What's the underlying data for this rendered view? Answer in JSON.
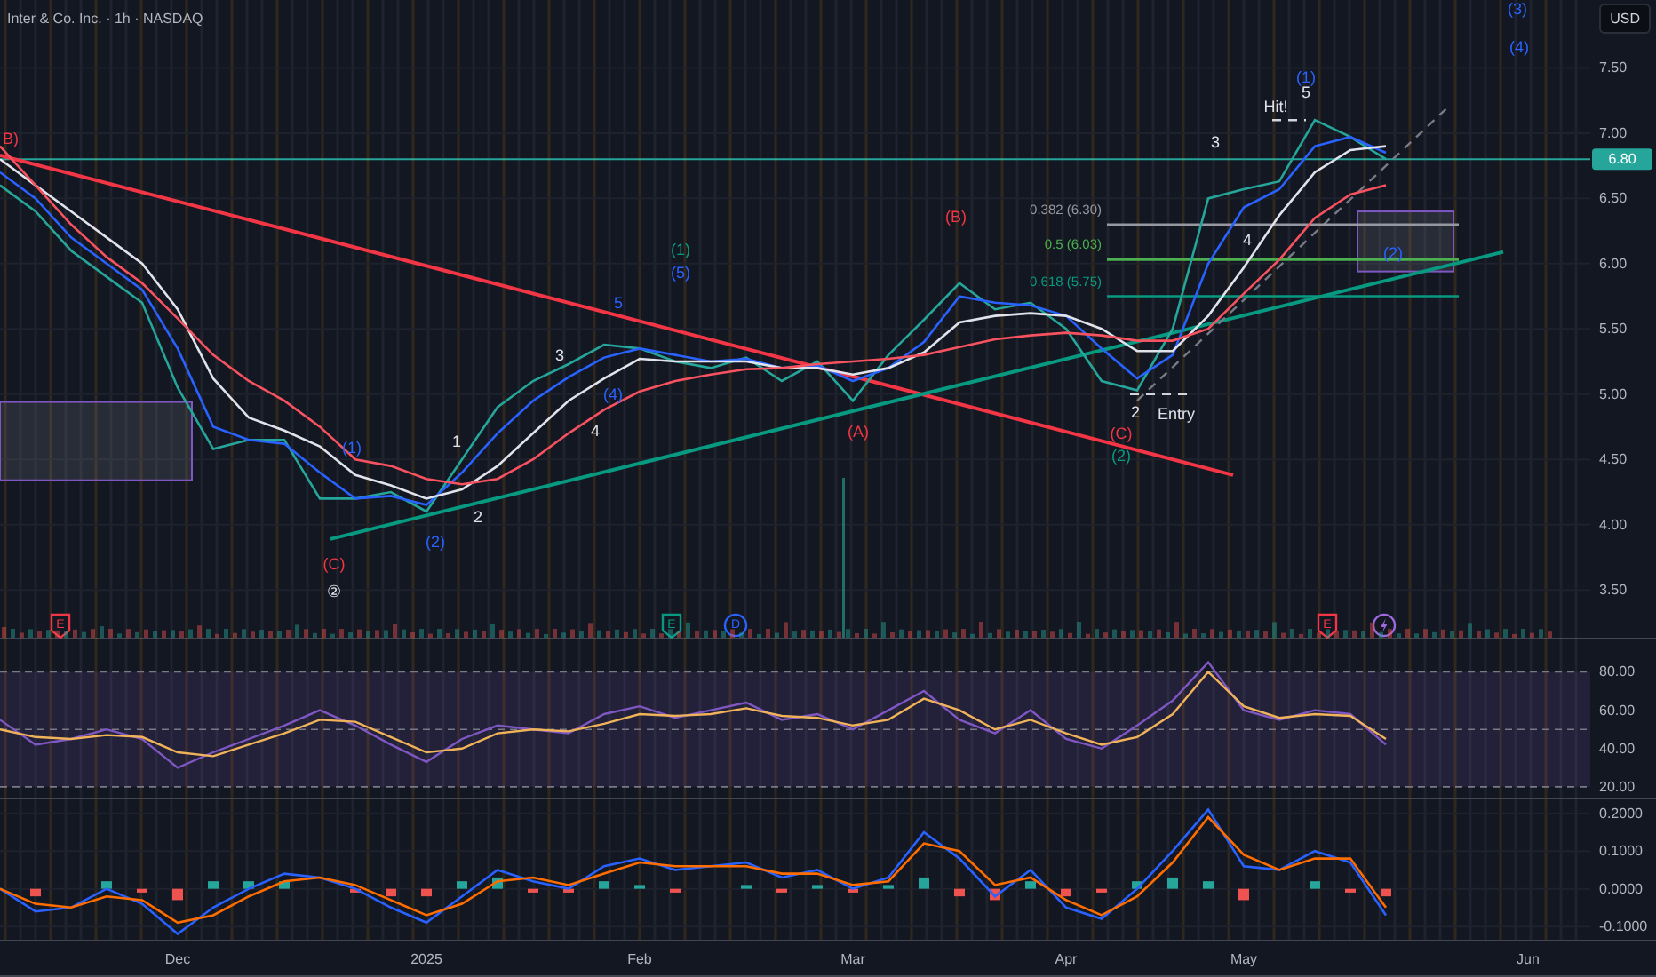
{
  "header": {
    "title": "Inter & Co. Inc. · 1h · NASDAQ",
    "currency": "USD"
  },
  "price_chart": {
    "chart_data": {
      "type": "line",
      "grid": true,
      "categories": [
        null,
        null,
        null,
        null,
        null,
        null,
        null,
        null,
        null,
        null,
        null,
        null,
        null,
        null,
        null,
        null,
        null,
        null,
        null,
        null,
        null,
        null,
        null,
        null,
        null,
        null,
        null,
        null,
        null,
        null,
        null,
        null,
        null,
        null,
        null,
        null,
        null,
        null,
        null,
        null,
        null,
        null,
        null,
        null,
        null
      ],
      "series": [
        {
          "color": "#26a69a",
          "values": [
            6.6,
            6.4,
            6.1,
            5.9,
            5.7,
            5.05,
            4.58,
            4.65,
            4.65,
            4.2,
            4.2,
            4.25,
            4.1,
            4.5,
            4.9,
            5.1,
            5.23,
            5.38,
            5.35,
            5.25,
            5.2,
            5.28,
            5.1,
            5.25,
            4.95,
            5.3,
            5.57,
            5.85,
            5.65,
            5.7,
            5.5,
            5.1,
            5.03,
            5.5,
            6.5,
            6.57,
            6.63,
            7.1,
            6.97,
            6.8,
            null,
            null,
            null,
            null,
            null
          ]
        },
        {
          "color": "#2962ff",
          "values": [
            6.7,
            6.5,
            6.2,
            6.0,
            5.8,
            5.35,
            4.75,
            4.65,
            4.62,
            4.4,
            4.2,
            4.22,
            4.15,
            4.4,
            4.7,
            4.95,
            5.13,
            5.28,
            5.35,
            5.3,
            5.25,
            5.27,
            5.2,
            5.22,
            5.1,
            5.2,
            5.4,
            5.75,
            5.7,
            5.68,
            5.6,
            5.35,
            5.12,
            5.3,
            6.0,
            6.43,
            6.57,
            6.9,
            6.97,
            6.85,
            null,
            null,
            null,
            null,
            null
          ]
        },
        {
          "color": "#e0e3eb",
          "values": [
            6.8,
            6.6,
            6.4,
            6.2,
            6.0,
            5.65,
            5.12,
            4.82,
            4.72,
            4.6,
            4.38,
            4.3,
            4.2,
            4.27,
            4.45,
            4.7,
            4.95,
            5.12,
            5.27,
            5.25,
            5.25,
            5.25,
            5.2,
            5.2,
            5.15,
            5.2,
            5.32,
            5.55,
            5.6,
            5.62,
            5.6,
            5.5,
            5.33,
            5.33,
            5.6,
            5.97,
            6.37,
            6.7,
            6.87,
            6.9,
            null,
            null,
            null,
            null,
            null
          ]
        },
        {
          "color": "#f7525f",
          "values": [
            6.9,
            6.6,
            6.3,
            6.05,
            5.85,
            5.58,
            5.3,
            5.1,
            4.95,
            4.75,
            4.5,
            4.45,
            4.35,
            4.31,
            4.35,
            4.5,
            4.7,
            4.88,
            5.02,
            5.1,
            5.15,
            5.19,
            5.2,
            5.23,
            5.25,
            5.27,
            5.3,
            5.36,
            5.42,
            5.45,
            5.47,
            5.45,
            5.41,
            5.41,
            5.5,
            5.77,
            6.03,
            6.35,
            6.53,
            6.6,
            null,
            null,
            null,
            null,
            null
          ]
        }
      ],
      "ylim": [
        3.12,
        8.02
      ],
      "yticks": [
        {
          "value": 3.5,
          "label": "3.50"
        },
        {
          "value": 4,
          "label": "4.00"
        },
        {
          "value": 4.5,
          "label": "4.50"
        },
        {
          "value": 5,
          "label": "5.00"
        },
        {
          "value": 5.5,
          "label": "5.50"
        },
        {
          "value": 6,
          "label": "6.00"
        },
        {
          "value": 6.5,
          "label": "6.50"
        },
        {
          "value": 7,
          "label": "7.00"
        },
        {
          "value": 7.5,
          "label": "7.50"
        }
      ]
    },
    "fib_levels": [
      {
        "label": "0.382 (6.30)",
        "color": "#9598a1"
      },
      {
        "label": "0.5 (6.03)",
        "color": "#4caf50"
      },
      {
        "label": "0.618 (5.75)",
        "color": "#089981"
      }
    ],
    "wave_labels": [
      {
        "text": "B)",
        "color": "#f23645"
      },
      {
        "text": "(1)",
        "color": "#089981"
      },
      {
        "text": "(5)",
        "color": "#2962ff"
      },
      {
        "text": "3",
        "color": "#e0e3eb"
      },
      {
        "text": "5",
        "color": "#2962ff"
      },
      {
        "text": "1",
        "color": "#e0e3eb"
      },
      {
        "text": "2",
        "color": "#e0e3eb"
      },
      {
        "text": "(1)",
        "color": "#2962ff"
      },
      {
        "text": "(2)",
        "color": "#2962ff"
      },
      {
        "text": "(C)",
        "color": "#f23645"
      },
      {
        "text": "②",
        "color": "#e0e3eb"
      },
      {
        "text": "(4)",
        "color": "#2962ff"
      },
      {
        "text": "4",
        "color": "#e0e3eb"
      },
      {
        "text": "(A)",
        "color": "#f23645"
      },
      {
        "text": "(B)",
        "color": "#f23645"
      },
      {
        "text": "(C)",
        "color": "#f23645"
      },
      {
        "text": "(2)",
        "color": "#089981"
      },
      {
        "text": "2",
        "color": "#e0e3eb"
      },
      {
        "text": "Entry",
        "color": "#e0e3eb"
      },
      {
        "text": "3",
        "color": "#e0e3eb"
      },
      {
        "text": "4",
        "color": "#e0e3eb"
      },
      {
        "text": "Hit!",
        "color": "#e0e3eb"
      },
      {
        "text": "(1)",
        "color": "#2962ff"
      },
      {
        "text": "5",
        "color": "#e0e3eb"
      },
      {
        "text": "(2)",
        "color": "#2962ff"
      },
      {
        "text": "(3)",
        "color": "#2962ff"
      },
      {
        "text": "(4)",
        "color": "#2962ff"
      }
    ],
    "last_price": {
      "text": "6.80",
      "color": "#26a69a"
    },
    "events": [
      {
        "kind": "badge",
        "text": "E",
        "color": "#f23645"
      },
      {
        "kind": "badge",
        "text": "E",
        "color": "#089981"
      },
      {
        "kind": "circle",
        "text": "D",
        "color": "#2962ff"
      },
      {
        "kind": "badge",
        "text": "E",
        "color": "#f23645"
      },
      {
        "kind": "bolt",
        "color": "#9c6ade"
      }
    ]
  },
  "rsi_chart": {
    "chart_data": {
      "type": "line",
      "grid": true,
      "categories": [
        null,
        null,
        null,
        null,
        null,
        null,
        null,
        null,
        null,
        null,
        null,
        null,
        null,
        null,
        null,
        null,
        null,
        null,
        null,
        null,
        null,
        null,
        null,
        null,
        null,
        null,
        null,
        null,
        null,
        null,
        null,
        null,
        null,
        null,
        null,
        null,
        null,
        null,
        null,
        null,
        null,
        null,
        null,
        null,
        null
      ],
      "series": [
        {
          "color": "#7e57c2",
          "values": [
            55,
            42,
            45,
            50,
            45,
            30,
            38,
            45,
            52,
            60,
            52,
            42,
            33,
            45,
            52,
            50,
            48,
            58,
            62,
            56,
            60,
            64,
            55,
            58,
            50,
            60,
            70,
            55,
            48,
            60,
            45,
            40,
            52,
            65,
            85,
            60,
            55,
            60,
            58,
            42,
            null,
            null,
            null,
            null,
            null
          ]
        },
        {
          "color": "#f0b35a",
          "values": [
            50,
            46,
            45,
            47,
            46,
            38,
            36,
            42,
            48,
            55,
            54,
            46,
            38,
            40,
            48,
            50,
            49,
            53,
            58,
            57,
            58,
            61,
            57,
            56,
            52,
            55,
            66,
            60,
            50,
            55,
            48,
            42,
            46,
            58,
            80,
            62,
            56,
            58,
            57,
            45,
            null,
            null,
            null,
            null,
            null
          ]
        }
      ],
      "ylim": [
        14.4,
        96.9
      ],
      "yticks": [
        {
          "value": 20,
          "label": "20.00"
        },
        {
          "value": 40,
          "label": "40.00"
        },
        {
          "value": 60,
          "label": "60.00"
        },
        {
          "value": 80,
          "label": "80.00"
        }
      ]
    }
  },
  "macd_chart": {
    "chart_data": {
      "type": "line",
      "grid": true,
      "categories": [
        null,
        null,
        null,
        null,
        null,
        "Dec",
        null,
        null,
        null,
        null,
        null,
        null,
        "2025",
        null,
        null,
        null,
        null,
        null,
        "Feb",
        null,
        null,
        null,
        null,
        null,
        "Mar",
        null,
        null,
        null,
        null,
        null,
        "Apr",
        null,
        null,
        null,
        null,
        "May",
        null,
        null,
        null,
        null,
        null,
        null,
        null,
        "Jun",
        null
      ],
      "series": [
        {
          "type": "bar",
          "color": "#26a69a",
          "values": [
            null,
            null,
            null,
            0.02,
            null,
            null,
            0.02,
            0.02,
            0.02,
            null,
            null,
            null,
            null,
            0.02,
            0.03,
            null,
            null,
            0.02,
            0.01,
            null,
            null,
            0.01,
            null,
            0.01,
            null,
            0.01,
            0.03,
            null,
            null,
            0.02,
            null,
            null,
            0.02,
            0.03,
            0.02,
            null,
            null,
            0.02,
            null,
            null,
            null,
            null,
            null,
            null,
            null
          ]
        },
        {
          "type": "bar",
          "color": "#ef5350",
          "values": [
            null,
            -0.02,
            null,
            null,
            -0.01,
            -0.03,
            null,
            null,
            null,
            null,
            -0.01,
            -0.02,
            -0.02,
            null,
            null,
            -0.01,
            -0.01,
            null,
            null,
            -0.01,
            null,
            null,
            -0.01,
            null,
            -0.01,
            null,
            null,
            -0.02,
            -0.03,
            null,
            -0.02,
            -0.01,
            null,
            null,
            null,
            -0.03,
            null,
            null,
            -0.01,
            -0.02,
            null,
            null,
            null,
            null,
            null
          ]
        },
        {
          "color": "#2962ff",
          "values": [
            0.0,
            -0.06,
            -0.05,
            0.0,
            -0.04,
            -0.12,
            -0.05,
            0.0,
            0.04,
            0.03,
            0.0,
            -0.05,
            -0.09,
            -0.02,
            0.05,
            0.02,
            0.0,
            0.06,
            0.08,
            0.05,
            0.06,
            0.07,
            0.03,
            0.05,
            0.0,
            0.03,
            0.15,
            0.08,
            -0.02,
            0.05,
            -0.05,
            -0.08,
            0.0,
            0.1,
            0.21,
            0.06,
            0.05,
            0.1,
            0.07,
            -0.07,
            null,
            null,
            null,
            null,
            null
          ]
        },
        {
          "color": "#ff6d00",
          "values": [
            0.0,
            -0.04,
            -0.05,
            -0.02,
            -0.03,
            -0.09,
            -0.07,
            -0.02,
            0.02,
            0.03,
            0.01,
            -0.03,
            -0.07,
            -0.04,
            0.02,
            0.03,
            0.01,
            0.04,
            0.07,
            0.06,
            0.06,
            0.06,
            0.04,
            0.04,
            0.01,
            0.02,
            0.12,
            0.1,
            0.01,
            0.03,
            -0.03,
            -0.07,
            -0.02,
            0.07,
            0.19,
            0.09,
            0.05,
            0.08,
            0.08,
            -0.05,
            null,
            null,
            null,
            null,
            null
          ]
        }
      ],
      "ylim": [
        -0.135,
        0.237
      ],
      "yticks": [
        {
          "value": -0.1,
          "label": "-0.1000"
        },
        {
          "value": 0,
          "label": "0.0000"
        },
        {
          "value": 0.1,
          "label": "0.1000"
        },
        {
          "value": 0.2,
          "label": "0.2000"
        }
      ]
    }
  }
}
